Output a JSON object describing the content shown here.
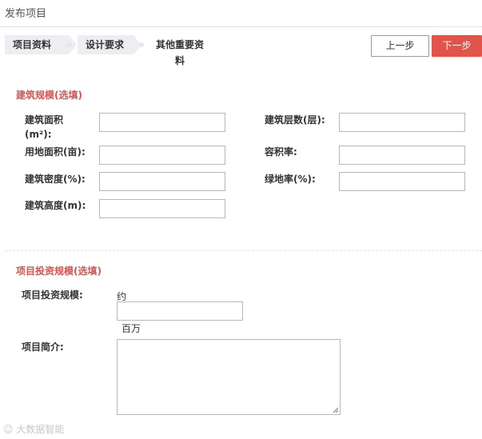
{
  "header": {
    "title": "发布项目"
  },
  "steps": [
    {
      "label": "项目资料"
    },
    {
      "label": "设计要求"
    },
    {
      "label": "其他重要资料"
    }
  ],
  "buttons": {
    "prev": "上一步",
    "next": "下一步"
  },
  "scale_section": {
    "title": "建筑规模(选填)",
    "fields": {
      "area": "建筑面积(m²):",
      "floors": "建筑层数(层):",
      "land_area": "用地面积(亩):",
      "plot_ratio": "容积率:",
      "density": "建筑密度(%):",
      "green_ratio": "绿地率(%):",
      "height": "建筑高度(m):"
    }
  },
  "invest_section": {
    "title": "项目投资规模(选填)",
    "scale_label": "项目投资规模:",
    "prefix": "约",
    "unit": "百万",
    "intro_label": "项目简介:"
  },
  "watermark": {
    "text": "大数据智能"
  }
}
